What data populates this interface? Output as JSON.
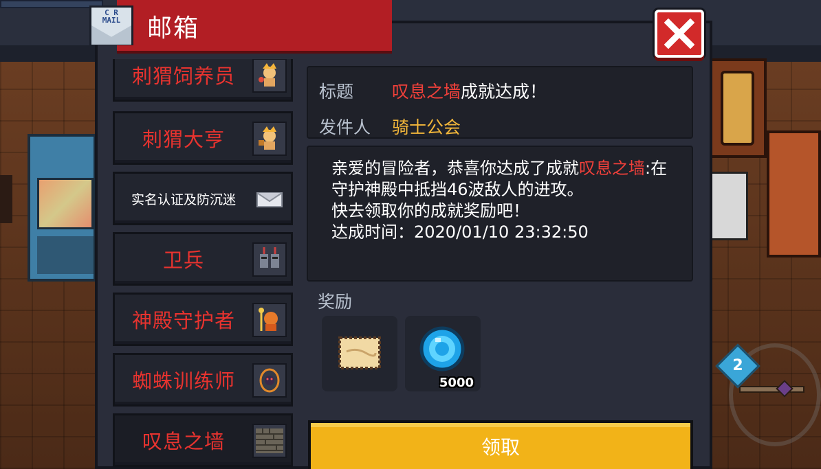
{
  "window": {
    "title": "邮箱",
    "mail_icon_text": "C R\nMAIL"
  },
  "colors": {
    "accent_red": "#e8332f",
    "sender_gold": "#f3b73a",
    "claim_button": "#f2b318",
    "panel_bg": "#2a2d3a"
  },
  "mail_list": [
    {
      "label": "刺猬饲养员",
      "icon": "hedgehog-knight-icon",
      "style": "red"
    },
    {
      "label": "刺猬大亨",
      "icon": "hedgehog-knight-icon",
      "style": "red"
    },
    {
      "label": "实名认证及防沉迷",
      "icon": "envelope-icon",
      "style": "white"
    },
    {
      "label": "卫兵",
      "icon": "guard-soldiers-icon",
      "style": "red"
    },
    {
      "label": "神殿守护者",
      "icon": "temple-guardian-icon",
      "style": "red"
    },
    {
      "label": "蜘蛛训练师",
      "icon": "spider-trainer-icon",
      "style": "red"
    },
    {
      "label": "叹息之墙",
      "icon": "stone-wall-icon",
      "style": "red",
      "selected": true
    }
  ],
  "detail": {
    "title_highlight": "叹息之墙",
    "title_rest": "成就达成！",
    "sender": "骑士公会",
    "body_line1_plain": "亲爱的冒险者，恭喜你达成了成就",
    "body_highlight": "叹息之墙",
    "body_line2_plain": ":在守护神殿中抵挡46波敌人的进攻。",
    "body_line3": "快去领取你的成就奖励吧！",
    "body_line4": "达成时间：2020/01/10 23:32:50"
  },
  "rewards": {
    "label": "奖励",
    "items": [
      {
        "icon": "parchment-scroll-icon",
        "count": ""
      },
      {
        "icon": "blue-gem-icon",
        "count": "5000"
      }
    ]
  },
  "claim_button": {
    "label": "领取"
  },
  "hud": {
    "badge_text": "2"
  }
}
